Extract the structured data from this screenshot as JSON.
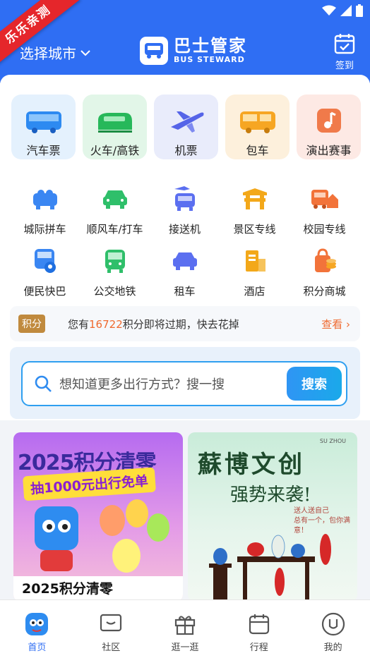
{
  "ribbon": "乐乐亲测",
  "header": {
    "city_label": "选择城市",
    "logo_title": "巴士管家",
    "logo_subtitle": "BUS STEWARD",
    "signin_label": "签到"
  },
  "tiles": [
    {
      "label": "汽车票",
      "icon": "bus-icon",
      "bg": "#e4f1fd"
    },
    {
      "label": "火车/高铁",
      "icon": "train-icon",
      "bg": "#e2f6e8"
    },
    {
      "label": "机票",
      "icon": "plane-icon",
      "bg": "#e9ecfb"
    },
    {
      "label": "包车",
      "icon": "charter-bus-icon",
      "bg": "#fdf0dc"
    },
    {
      "label": "演出赛事",
      "icon": "music-icon",
      "bg": "#fde9e4"
    }
  ],
  "grid_row1": [
    {
      "label": "城际拼车",
      "icon": "carpool-icon"
    },
    {
      "label": "顺风车/打车",
      "icon": "car-icon"
    },
    {
      "label": "接送机",
      "icon": "airport-shuttle-icon"
    },
    {
      "label": "景区专线",
      "icon": "scenic-gate-icon"
    },
    {
      "label": "校园专线",
      "icon": "campus-bus-icon"
    }
  ],
  "grid_row2": [
    {
      "label": "便民快巴",
      "icon": "quick-bus-icon"
    },
    {
      "label": "公交地铁",
      "icon": "transit-icon"
    },
    {
      "label": "租车",
      "icon": "rental-car-icon"
    },
    {
      "label": "酒店",
      "icon": "hotel-icon"
    },
    {
      "label": "积分商城",
      "icon": "points-mall-icon"
    }
  ],
  "points": {
    "badge": "积分",
    "prefix": "您有",
    "amount": "16722",
    "suffix": "积分即将过期，快去花掉",
    "more": "查看 ›"
  },
  "search": {
    "placeholder": "想知道更多出行方式？搜一搜",
    "button": "搜索"
  },
  "banners": {
    "left": {
      "title": "2025积分清零",
      "subtitle": "抽1000元出行免单",
      "caption": "2025积分清零"
    },
    "right": {
      "tag": "SU ZHOU",
      "title": "蘇博文创",
      "subtitle": "强势来袭!",
      "slogan_line1": "送人送自己",
      "slogan_line2": "总有一个，包你满意！"
    }
  },
  "tabbar": [
    {
      "label": "首页",
      "icon": "home-mascot-icon"
    },
    {
      "label": "社区",
      "icon": "community-icon"
    },
    {
      "label": "逛一逛",
      "icon": "gift-icon"
    },
    {
      "label": "行程",
      "icon": "trip-icon"
    },
    {
      "label": "我的",
      "icon": "profile-icon"
    }
  ],
  "colors": {
    "brand": "#2f6ef3",
    "accent": "#ef6a2f",
    "search": "#2f9ff0"
  }
}
